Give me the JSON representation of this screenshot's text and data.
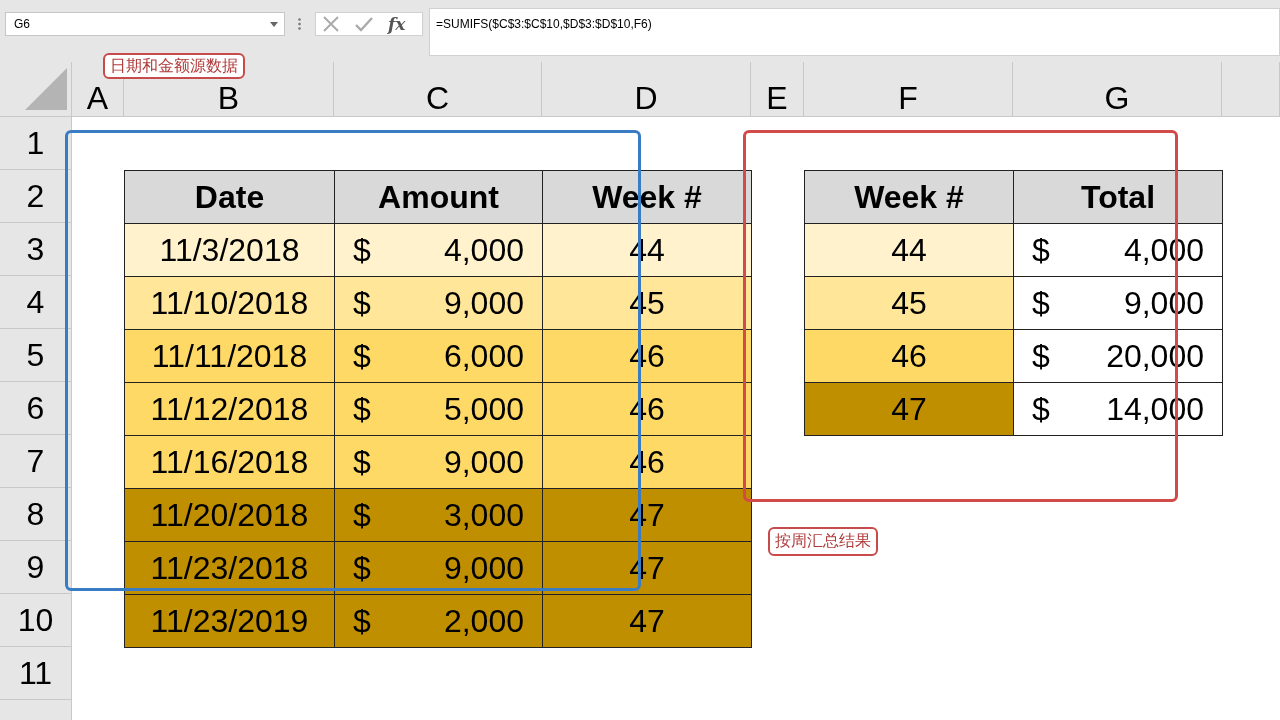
{
  "name_box": "G6",
  "formula_icons": {
    "function_label": "fx"
  },
  "formula": "=SUMIFS($C$3:$C$10,$D$3:$D$10,F6)",
  "columns": [
    "A",
    "B",
    "C",
    "D",
    "E",
    "F",
    "G"
  ],
  "row_numbers": [
    "1",
    "2",
    "3",
    "4",
    "5",
    "6",
    "7",
    "8",
    "9",
    "10",
    "11"
  ],
  "source_table": {
    "headers": [
      "Date",
      "Amount",
      "Week #"
    ],
    "rows": [
      {
        "date": "11/3/2018",
        "currency": "$",
        "amount": "4,000",
        "week": "44",
        "color": "#fff2cc"
      },
      {
        "date": "11/10/2018",
        "currency": "$",
        "amount": "9,000",
        "week": "45",
        "color": "#ffe699"
      },
      {
        "date": "11/11/2018",
        "currency": "$",
        "amount": "6,000",
        "week": "46",
        "color": "#ffd966"
      },
      {
        "date": "11/12/2018",
        "currency": "$",
        "amount": "5,000",
        "week": "46",
        "color": "#ffd966"
      },
      {
        "date": "11/16/2018",
        "currency": "$",
        "amount": "9,000",
        "week": "46",
        "color": "#ffd966"
      },
      {
        "date": "11/20/2018",
        "currency": "$",
        "amount": "3,000",
        "week": "47",
        "color": "#bf8f00"
      },
      {
        "date": "11/23/2018",
        "currency": "$",
        "amount": "9,000",
        "week": "47",
        "color": "#bf8f00"
      },
      {
        "date": "11/23/2019",
        "currency": "$",
        "amount": "2,000",
        "week": "47",
        "color": "#bf8f00"
      }
    ]
  },
  "summary_table": {
    "headers": [
      "Week #",
      "Total"
    ],
    "rows": [
      {
        "week": "44",
        "currency": "$",
        "total": "4,000",
        "color": "#fff2cc"
      },
      {
        "week": "45",
        "currency": "$",
        "total": "9,000",
        "color": "#ffe699"
      },
      {
        "week": "46",
        "currency": "$",
        "total": "20,000",
        "color": "#ffd966"
      },
      {
        "week": "47",
        "currency": "$",
        "total": "14,000",
        "color": "#bf8f00"
      }
    ]
  },
  "annotations": [
    {
      "kind": "source",
      "text": "日期和金额源数据"
    },
    {
      "kind": "summary",
      "text": "按周汇总结果"
    }
  ]
}
